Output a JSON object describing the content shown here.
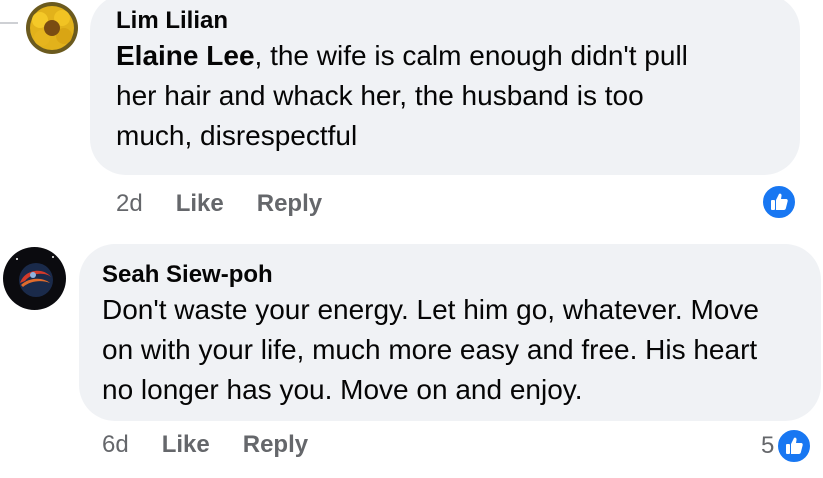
{
  "comments": [
    {
      "author": "Lim Lilian",
      "mention": "Elaine Lee",
      "lines": [
        ", the wife is calm enough didn't pull",
        "her hair and whack her, the husband is too",
        "much, disrespectful"
      ],
      "time": "2d",
      "like_label": "Like",
      "reply_label": "Reply",
      "reaction_count": "",
      "avatar_icon": "sunflower-avatar",
      "reaction_icon": "thumbs-up-icon"
    },
    {
      "author": "Seah Siew-poh",
      "lines": [
        "Don't waste your energy. Let him go, whatever. Move",
        "on with your life, much more easy and free. His heart",
        "no longer has you. Move on and enjoy."
      ],
      "time": "6d",
      "like_label": "Like",
      "reply_label": "Reply",
      "reaction_count": "5",
      "avatar_icon": "dark-earth-avatar",
      "reaction_icon": "thumbs-up-icon"
    }
  ],
  "colors": {
    "bubble_bg": "#f0f2f5",
    "text": "#050505",
    "meta": "#65676b",
    "like_blue": "#1877f2"
  }
}
